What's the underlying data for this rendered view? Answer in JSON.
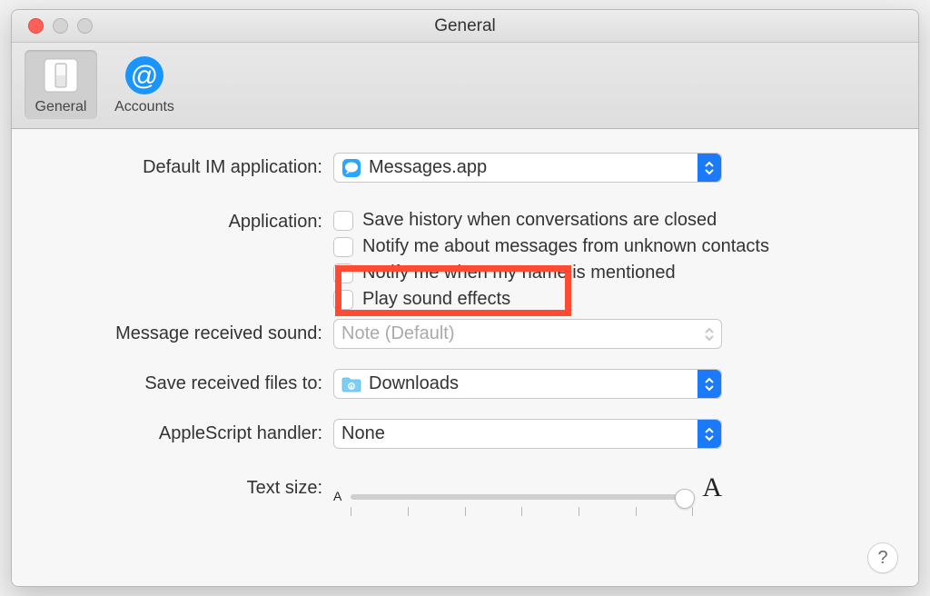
{
  "window": {
    "title": "General"
  },
  "toolbar": {
    "tabs": [
      {
        "label": "General",
        "selected": true
      },
      {
        "label": "Accounts",
        "selected": false
      }
    ]
  },
  "form": {
    "default_im_label": "Default IM application:",
    "default_im_value": "Messages.app",
    "application_label": "Application:",
    "checks": {
      "save_history": "Save history when conversations are closed",
      "notify_unknown": "Notify me about messages from unknown contacts",
      "notify_name": "Notify me when my name is mentioned",
      "play_sound": "Play sound effects"
    },
    "received_sound_label": "Message received sound:",
    "received_sound_value": "Note (Default)",
    "save_files_label": "Save received files to:",
    "save_files_value": "Downloads",
    "applescript_label": "AppleScript handler:",
    "applescript_value": "None",
    "textsize_label": "Text size:",
    "textsize_small": "A",
    "textsize_big": "A"
  },
  "icons": {
    "help": "?"
  }
}
